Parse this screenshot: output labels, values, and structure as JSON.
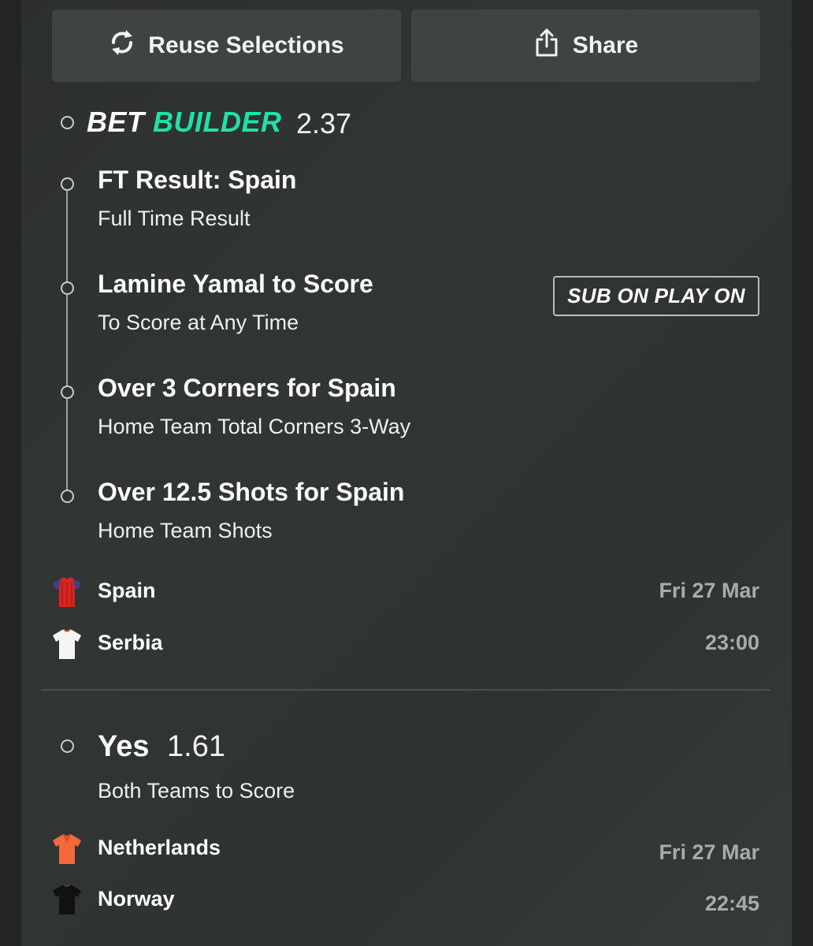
{
  "actions": {
    "reuse_label": "Reuse Selections",
    "share_label": "Share"
  },
  "bet_builder": {
    "title_part1": "BET",
    "title_part2": "BUILDER",
    "odds": "2.37",
    "selections": [
      {
        "title": "FT Result: Spain",
        "subtitle": "Full Time Result"
      },
      {
        "title": "Lamine Yamal to Score",
        "subtitle": "To Score at Any Time",
        "badge": "SUB ON PLAY ON"
      },
      {
        "title": "Over 3 Corners for Spain",
        "subtitle": "Home Team Total Corners 3-Way"
      },
      {
        "title": "Over 12.5 Shots for Spain",
        "subtitle": "Home Team Shots"
      }
    ],
    "match": {
      "home": "Spain",
      "away": "Serbia",
      "date": "Fri 27 Mar",
      "time": "23:00"
    }
  },
  "single_bet": {
    "selection": "Yes",
    "odds": "1.61",
    "market": "Both Teams to Score",
    "match": {
      "home": "Netherlands",
      "away": "Norway",
      "date": "Fri 27 Mar",
      "time": "22:45"
    }
  },
  "colors": {
    "accent_green": "#1fe0a5",
    "background": "#2f3331",
    "button": "#3f4442",
    "kit_spain": "#d8261f",
    "kit_serbia": "#f5f5f5",
    "kit_netherlands": "#f26a3c",
    "kit_norway": "#111111"
  }
}
